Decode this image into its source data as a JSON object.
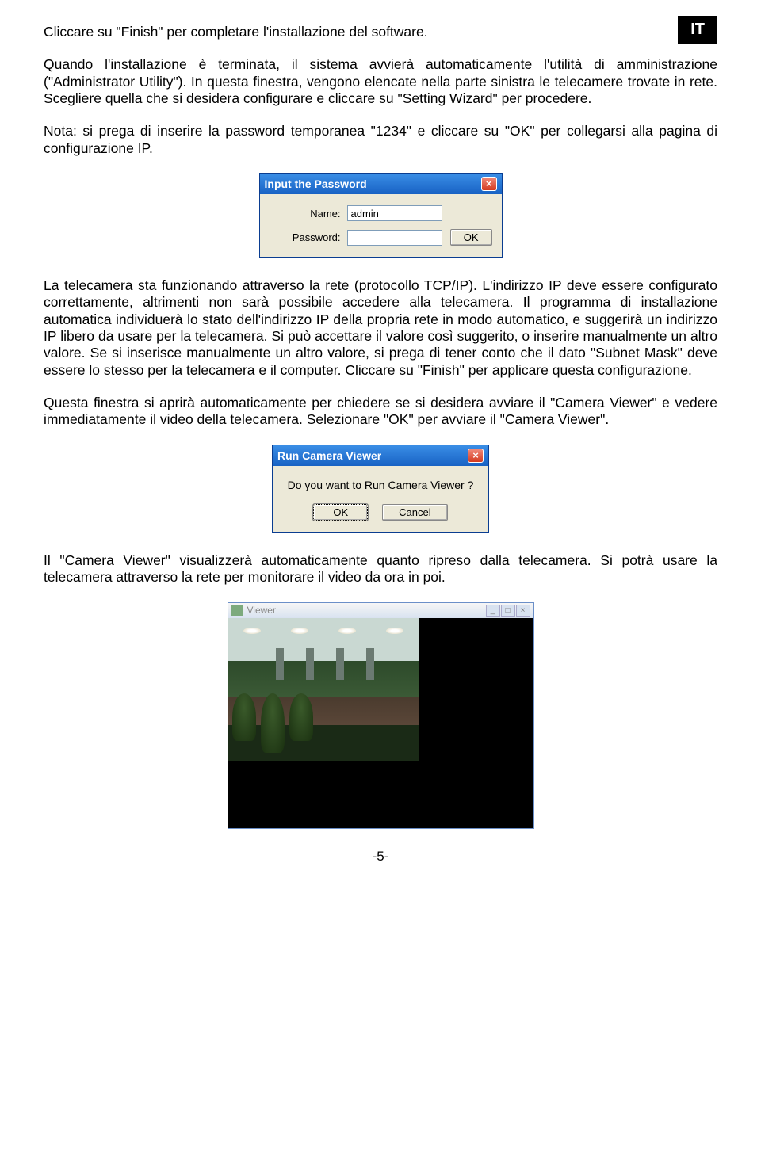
{
  "lang_badge": "IT",
  "para1": "Cliccare su \"Finish\" per completare l'installazione del software.",
  "para2": "Quando l'installazione è terminata, il sistema avvierà automaticamente l'utilità di amministrazione (\"Administrator Utility\"). In questa finestra, vengono elencate nella parte sinistra le telecamere trovate in rete. Scegliere quella che si desidera configurare e cliccare su \"Setting Wizard\" per procedere.",
  "para3": "Nota: si prega di inserire la password temporanea \"1234\" e cliccare su \"OK\" per collegarsi alla pagina di configurazione IP.",
  "dialog1": {
    "title": "Input the Password",
    "name_label": "Name:",
    "name_value": "admin",
    "password_label": "Password:",
    "password_value": "",
    "ok": "OK"
  },
  "para4": "La telecamera sta funzionando attraverso la rete (protocollo TCP/IP). L'indirizzo IP deve essere configurato correttamente, altrimenti non sarà possibile accedere alla telecamera. Il programma di installazione automatica individuerà lo stato dell'indirizzo IP della propria rete in modo automatico, e suggerirà un indirizzo IP libero da usare per la telecamera. Si può accettare il valore così suggerito, o inserire manualmente un altro valore. Se si inserisce manualmente un altro valore, si prega di tener conto che il dato \"Subnet Mask\" deve essere lo stesso per la telecamera e il computer. Cliccare su \"Finish\" per applicare questa configurazione.",
  "para5": "Questa finestra si aprirà automaticamente per chiedere se si desidera avviare il \"Camera Viewer\" e vedere immediatamente il video della telecamera. Selezionare  \"OK\" per avviare il \"Camera Viewer\".",
  "dialog2": {
    "title": "Run Camera Viewer",
    "message": "Do you want to Run Camera Viewer ?",
    "ok": "OK",
    "cancel": "Cancel"
  },
  "para6": "Il \"Camera Viewer\" visualizzerà automaticamente quanto ripreso dalla telecamera. Si potrà usare la telecamera attraverso la rete per monitorare il video da ora in poi.",
  "viewer": {
    "title": "Viewer"
  },
  "page_number": "-5-"
}
